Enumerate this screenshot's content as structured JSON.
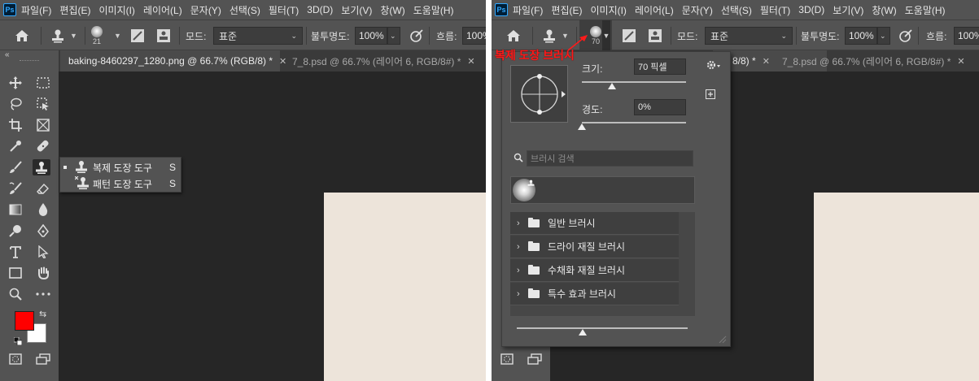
{
  "menu": [
    "파일(F)",
    "편집(E)",
    "이미지(I)",
    "레이어(L)",
    "문자(Y)",
    "선택(S)",
    "필터(T)",
    "3D(D)",
    "보기(V)",
    "창(W)",
    "도움말(H)"
  ],
  "ps_logo": "Ps",
  "options": {
    "brush_size_left": "21",
    "brush_size_right": "70",
    "mode_label": "모드:",
    "mode_value": "표준",
    "opacity_label": "불투명도:",
    "opacity_value": "100%",
    "flow_label": "흐름:",
    "flow_value": "100%"
  },
  "tabs_left": [
    {
      "label": "baking-8460297_1280.png @ 66.7% (RGB/8) *",
      "active": true
    },
    {
      "label": "7_8.psd @ 66.7% (레이어 6, RGB/8#) *",
      "active": false
    }
  ],
  "tabs_right": [
    {
      "label": "8/8) *",
      "active": true
    },
    {
      "label": "7_8.psd @ 66.7% (레이어 6, RGB/8#) *",
      "active": false
    }
  ],
  "flyout": {
    "items": [
      {
        "label": "복제 도장 도구",
        "key": "S",
        "selected": true
      },
      {
        "label": "패턴 도장 도구",
        "key": "S",
        "selected": false
      }
    ]
  },
  "picker": {
    "size_label": "크기:",
    "size_value": "70 픽셀",
    "size_fraction": 0.29,
    "hardness_label": "경도:",
    "hardness_value": "0%",
    "hardness_fraction": 0.0,
    "search_placeholder": "브러시 검색",
    "groups": [
      "일반 브러시",
      "드라이 재질 브러시",
      "수채화 재질 브러시",
      "특수 효과 브러시"
    ]
  },
  "annotation": "복제 도장 브러시",
  "colors": {
    "foreground": "#ff0000",
    "background": "#ffffff",
    "annotation": "#ff1a1a",
    "document": "#ede4da"
  }
}
